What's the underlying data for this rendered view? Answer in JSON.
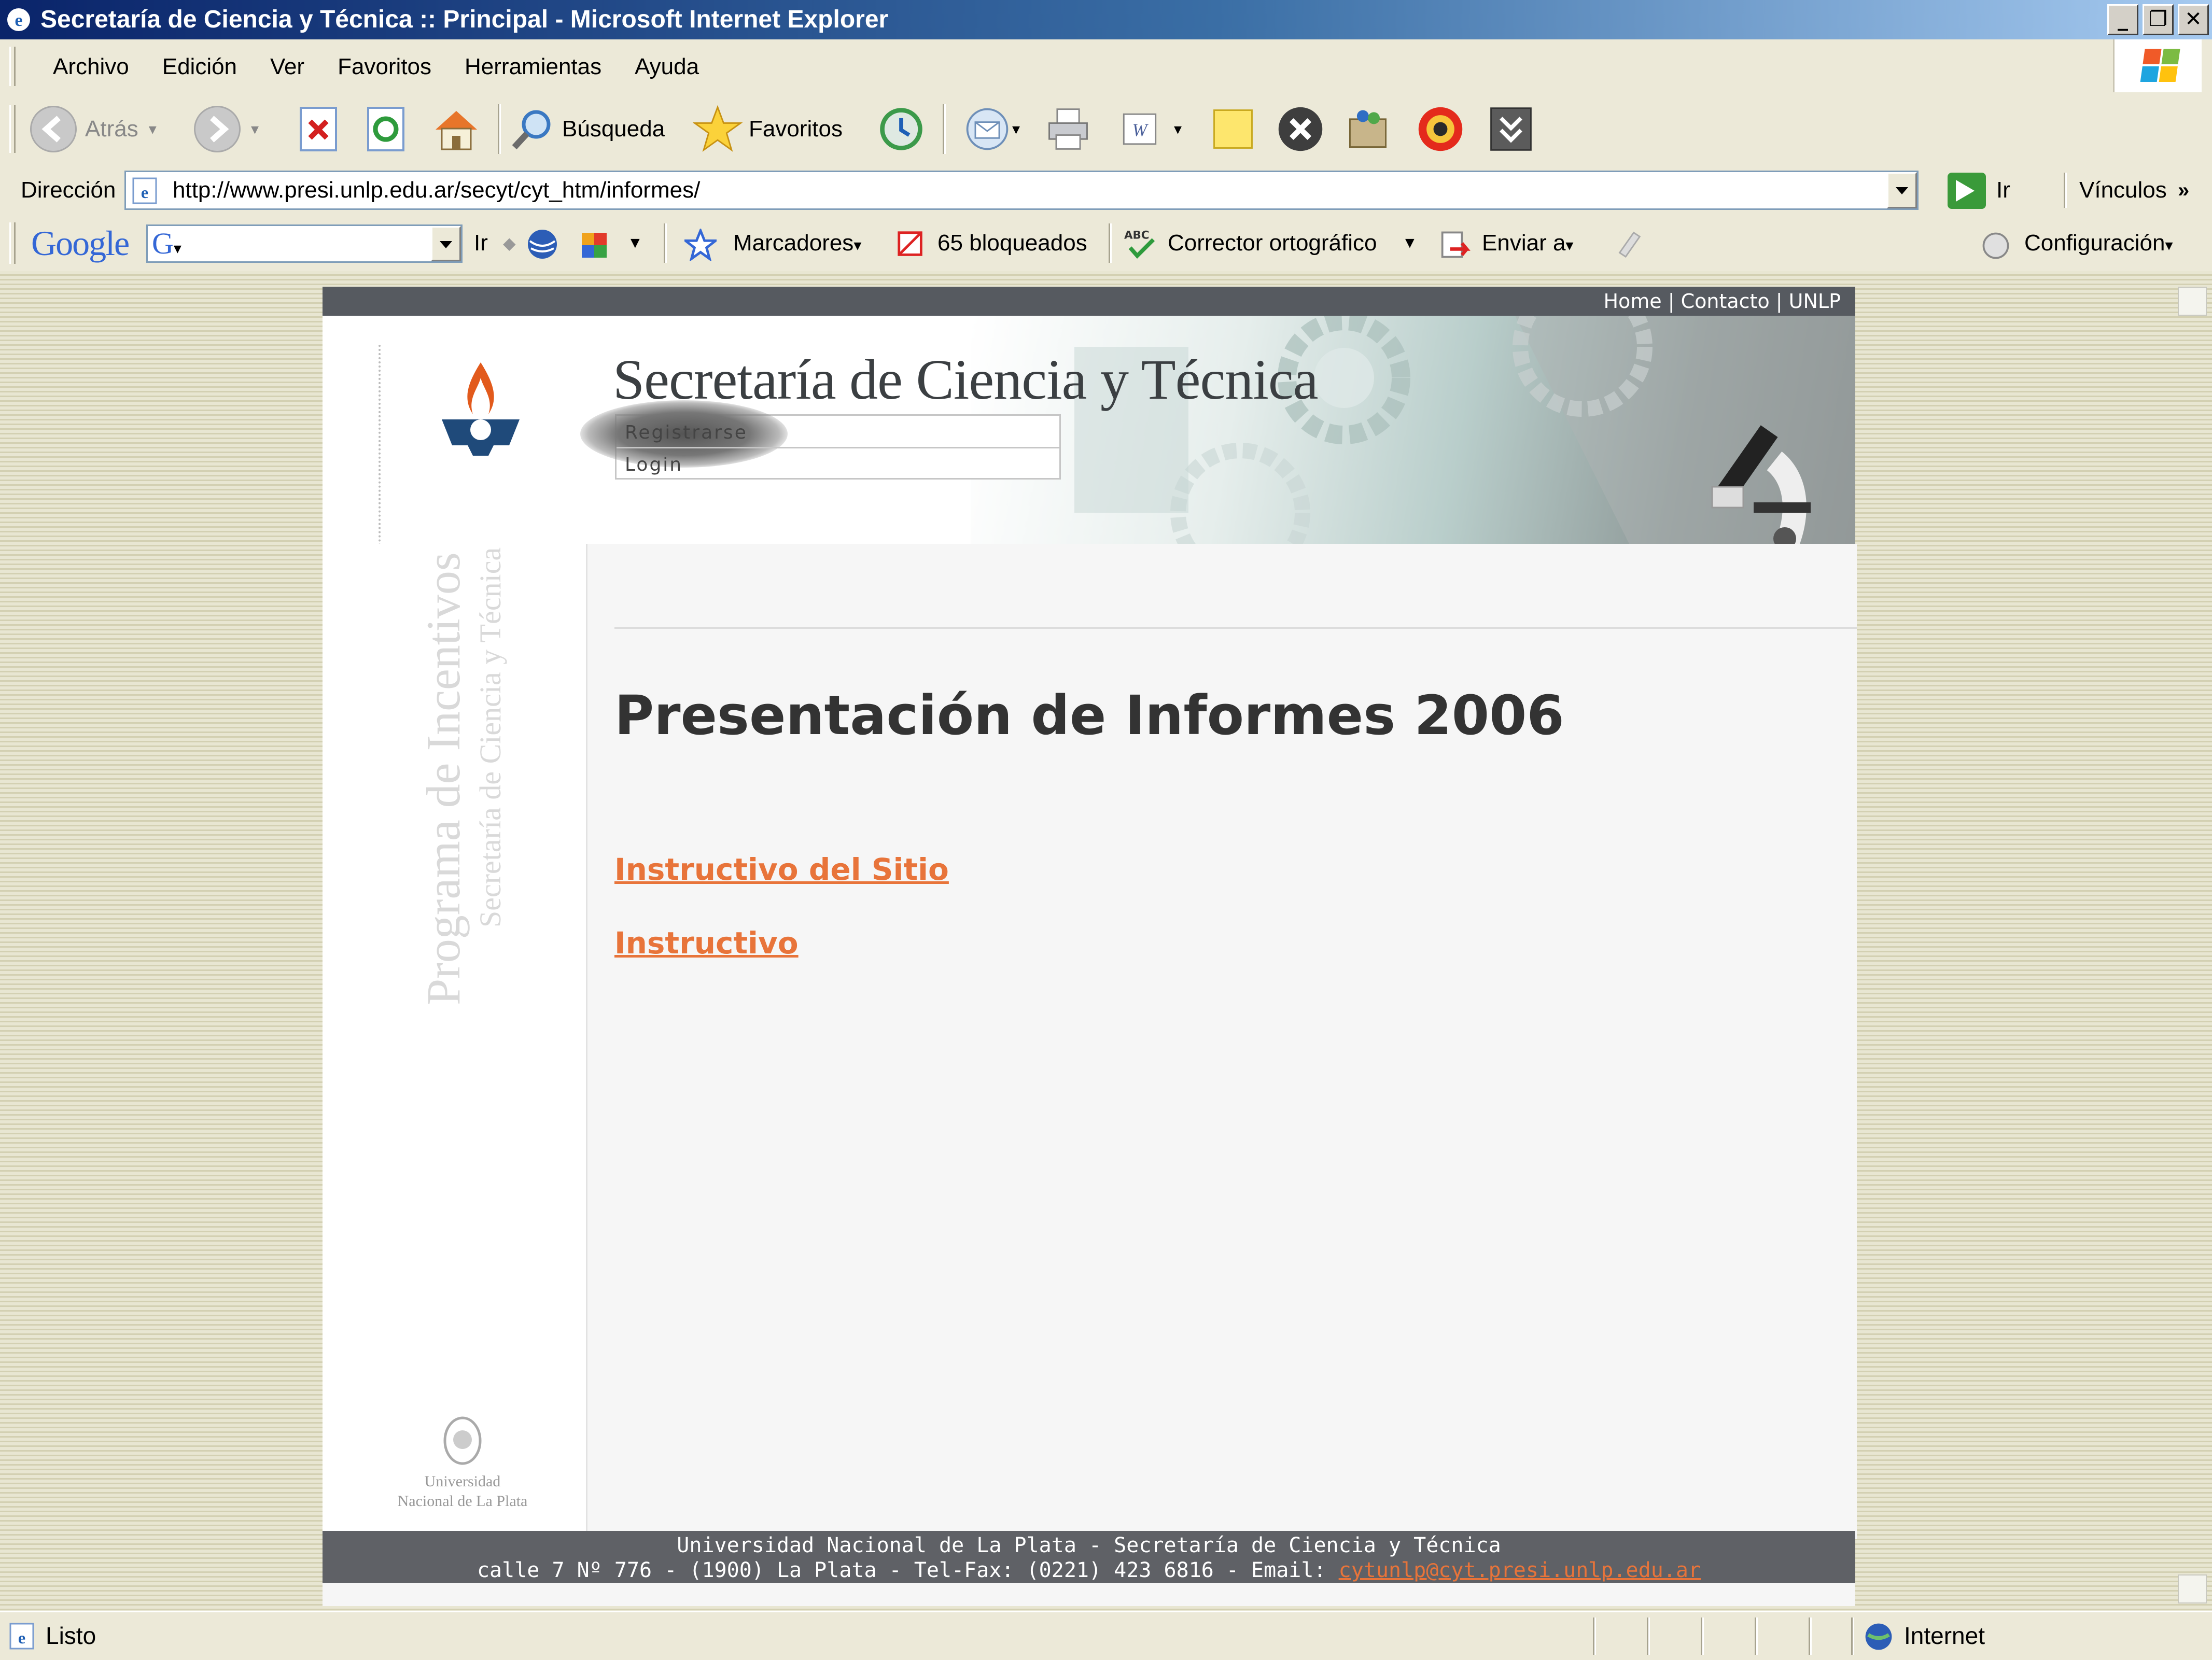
{
  "window": {
    "title": "Secretaría de Ciencia y Técnica :: Principal - Microsoft Internet Explorer"
  },
  "menu": [
    "Archivo",
    "Edición",
    "Ver",
    "Favoritos",
    "Herramientas",
    "Ayuda"
  ],
  "toolbar": {
    "back": "Atrás",
    "search": "Búsqueda",
    "favorites": "Favoritos"
  },
  "address": {
    "label": "Dirección",
    "url": "http://www.presi.unlp.edu.ar/secyt/cyt_htm/informes/",
    "go": "Ir",
    "links": "Vínculos"
  },
  "google_bar": {
    "logo": "Google",
    "go": "Ir",
    "bookmarks": "Marcadores",
    "blocked": "65 bloqueados",
    "spell": "Corrector ortográfico",
    "send": "Enviar a",
    "settings": "Configuración"
  },
  "page": {
    "top_links": "Home | Contacto | UNLP",
    "site_title": "Secretaría de Ciencia y Técnica",
    "register": "Registrarse",
    "login": "Login",
    "side_title": "Programa de Incentivos",
    "side_subtitle": "Secretaría de Ciencia y Técnica",
    "university": "Universidad Nacional de La Plata",
    "heading": "Presentación de Informes 2006",
    "links": [
      "Instructivo del Sitio",
      "Instructivo"
    ],
    "footer_line1": "Universidad Nacional de La Plata - Secretaría de Ciencia y Técnica",
    "footer_line2": "calle 7 Nº 776 - (1900) La Plata - Tel-Fax: (0221) 423 6816 - Email: ",
    "footer_email": "cytunlp@cyt.presi.unlp.edu.ar"
  },
  "status": {
    "text": "Listo",
    "zone": "Internet"
  },
  "colors": {
    "link": "#e8743a",
    "title_bar": "#0a246a",
    "strip": "#565a60"
  }
}
